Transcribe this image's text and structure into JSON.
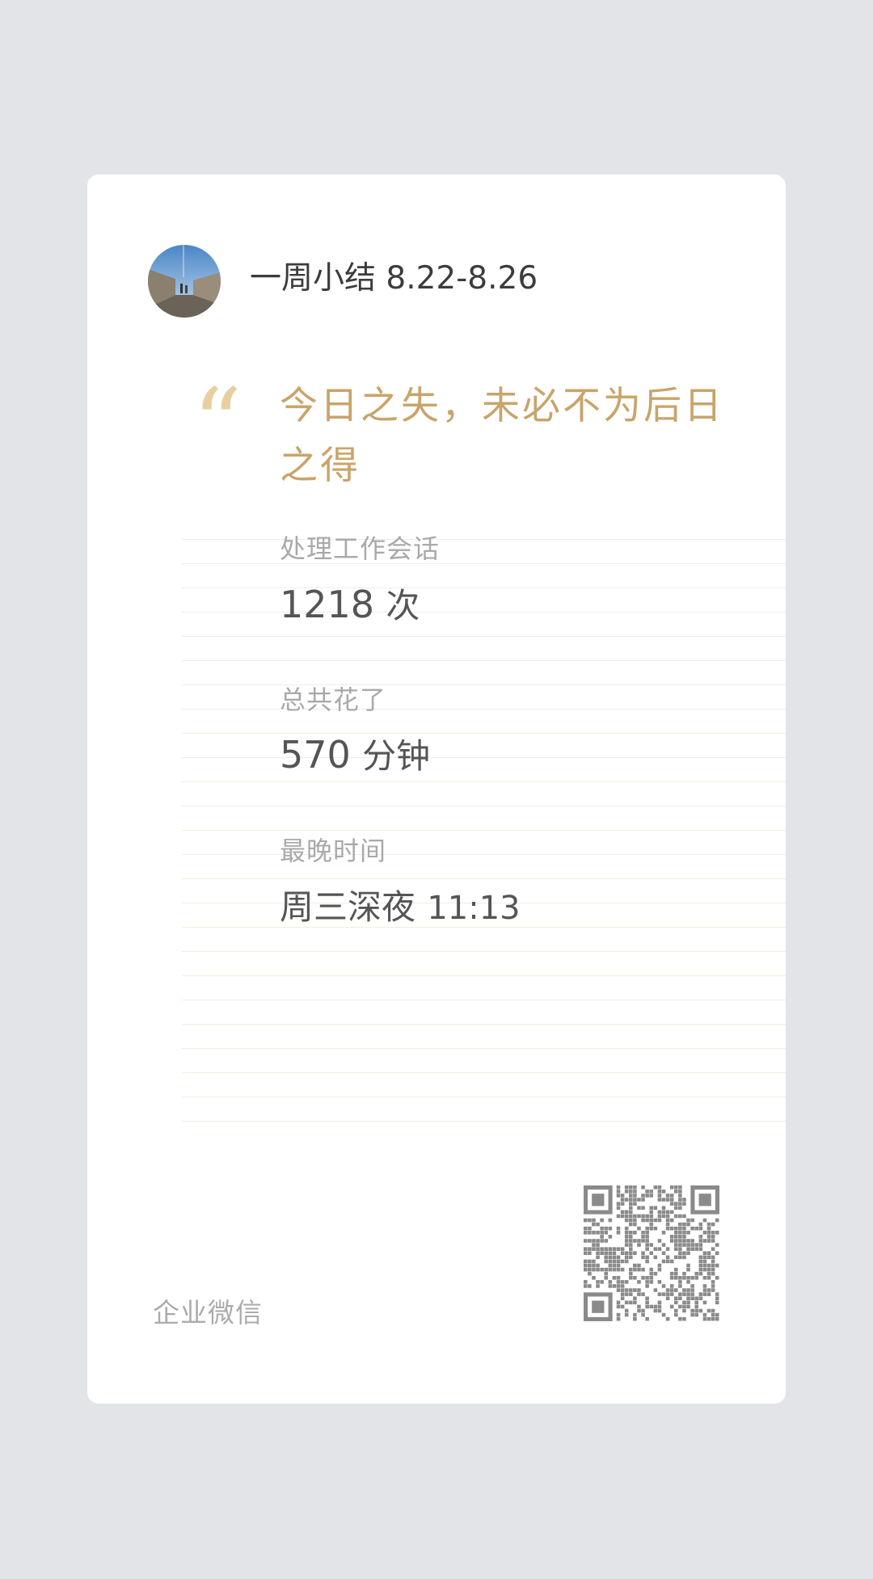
{
  "header": {
    "avatar_icon": "avatar-photo-icon",
    "title": "一周小结 8.22-8.26"
  },
  "quote": {
    "mark": "“",
    "text": "今日之失，未必不为后日之得"
  },
  "stats": [
    {
      "label": "处理工作会话",
      "value": "1218",
      "unit": "次"
    },
    {
      "label": "总共花了",
      "value": "570",
      "unit": "分钟"
    },
    {
      "label": "最晚时间",
      "value_prefix": "周三深夜",
      "value": "11:13"
    }
  ],
  "footer": {
    "brand": "企业微信",
    "qr_icon": "qr-code-icon"
  },
  "colors": {
    "background": "#e3e4e8",
    "card": "#ffffff",
    "quote": "#c9a46a",
    "quote_mark": "#e8cfa2"
  }
}
